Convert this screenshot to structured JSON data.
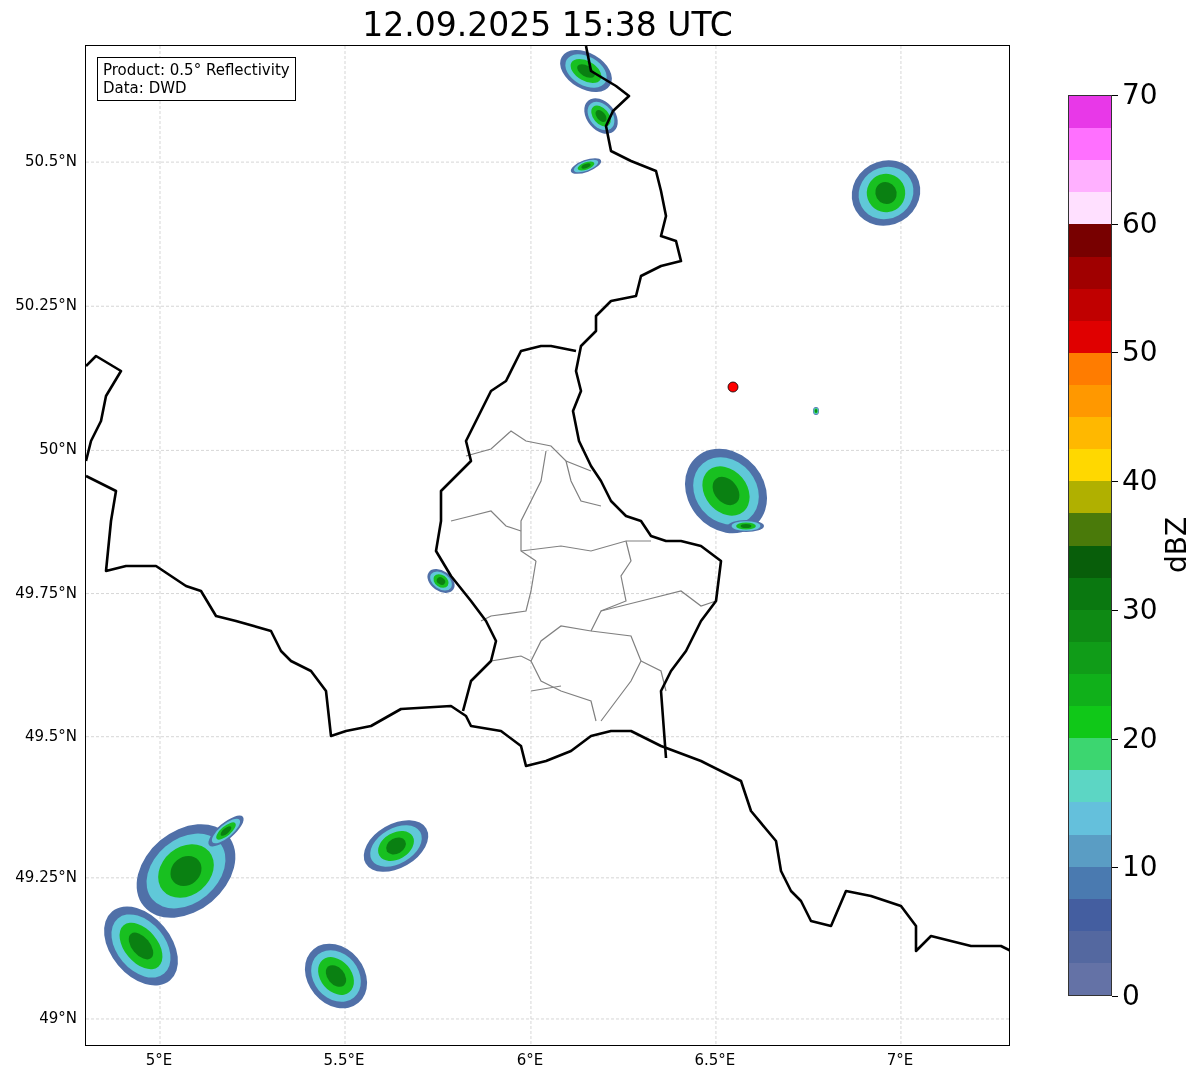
{
  "title": "12.09.2025 15:38 UTC",
  "legend": [
    "Product: 0.5° Reflectivity",
    "Data: DWD"
  ],
  "y_ticks": [
    "50.5°N",
    "50.25°N",
    "50°N",
    "49.75°N",
    "49.5°N",
    "49.25°N",
    "49°N"
  ],
  "x_ticks": [
    "5°E",
    "5.5°E",
    "6°E",
    "6.5°E",
    "7°E"
  ],
  "colorbar": {
    "label": "dBZ",
    "ticks": [
      "70",
      "60",
      "50",
      "40",
      "30",
      "20",
      "10",
      "0"
    ],
    "segments": [
      {
        "color": "#e838e8"
      },
      {
        "color": "#ff70ff"
      },
      {
        "color": "#ffb0ff"
      },
      {
        "color": "#ffe0ff"
      },
      {
        "color": "#780000"
      },
      {
        "color": "#a00000"
      },
      {
        "color": "#c00000"
      },
      {
        "color": "#e00000"
      },
      {
        "color": "#ff7c00"
      },
      {
        "color": "#ff9800"
      },
      {
        "color": "#ffb800"
      },
      {
        "color": "#ffd800"
      },
      {
        "color": "#b0b000"
      },
      {
        "color": "#4a7a0a"
      },
      {
        "color": "#085e0a"
      },
      {
        "color": "#0a7810"
      },
      {
        "color": "#0e8a14"
      },
      {
        "color": "#109c18"
      },
      {
        "color": "#10b01a"
      },
      {
        "color": "#10c818"
      },
      {
        "color": "#3cd670"
      },
      {
        "color": "#5cd6c4"
      },
      {
        "color": "#64c0dc"
      },
      {
        "color": "#5a9dc4"
      },
      {
        "color": "#4a7ab0"
      },
      {
        "color": "#445ea0"
      },
      {
        "color": "#5468a0"
      },
      {
        "color": "#6472a6"
      }
    ]
  }
}
